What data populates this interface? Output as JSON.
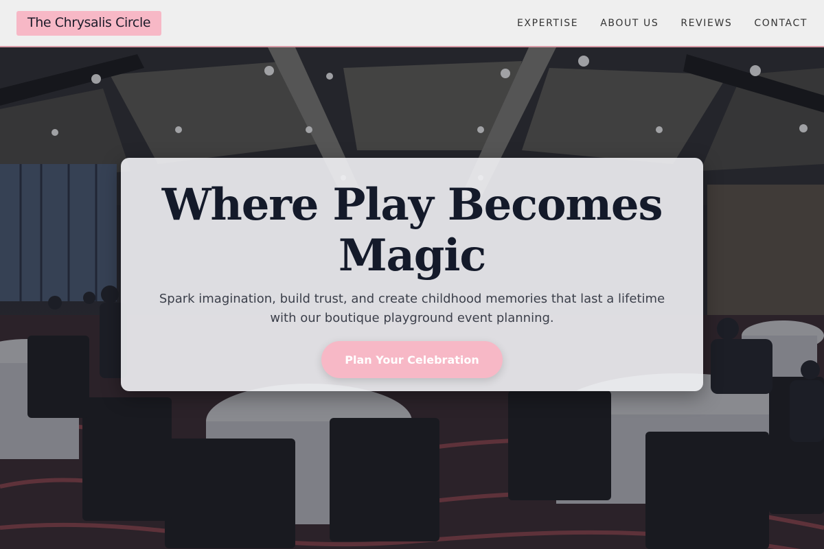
{
  "header": {
    "logo_text": "The Chrysalis Circle",
    "nav": [
      {
        "label": "EXPERTISE"
      },
      {
        "label": "ABOUT US"
      },
      {
        "label": "REVIEWS"
      },
      {
        "label": "CONTACT"
      }
    ]
  },
  "hero": {
    "headline": "Where Play Becomes Magic",
    "subheadline": "Spark imagination, build trust, and create childhood memories that last a lifetime with our boutique playground event planning.",
    "cta_label": "Plan Your Celebration",
    "background_image": "banquet-hall-photo"
  },
  "colors": {
    "accent_pink": "#f7b8c6",
    "header_bg": "#efefef",
    "headline": "#141a2a"
  }
}
